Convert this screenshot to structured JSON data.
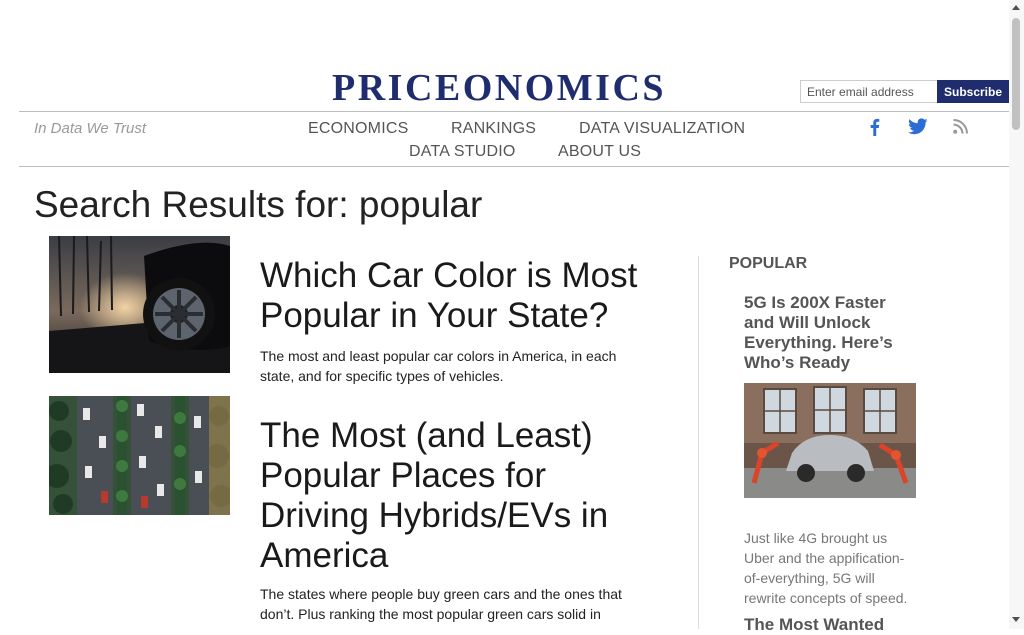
{
  "header": {
    "logo": "PRICEONOMICS",
    "email_placeholder": "Enter email address",
    "subscribe_label": "Subscribe",
    "tagline": "In Data We Trust"
  },
  "nav": {
    "economics": "ECONOMICS",
    "rankings": "RANKINGS",
    "data_visualization": "DATA VISUALIZATION",
    "data_studio": "DATA STUDIO",
    "about_us": "ABOUT US"
  },
  "social": [
    "facebook-icon",
    "twitter-icon",
    "rss-icon"
  ],
  "colors": {
    "brand": "#1f2d6e",
    "social": "#2b6cd6",
    "nav_text": "#555555",
    "sidebar_text": "#555555"
  },
  "search": {
    "title": "Search Results for: popular"
  },
  "results": [
    {
      "title": "Which Car Color is Most Popular in Your State?",
      "excerpt": "The most and least popular car colors in America, in each state, and for specific types of vehicles."
    },
    {
      "title": "The Most (and Least) Popular Places for Driving Hybrids/EVs in America",
      "excerpt": "The states where people buy green cars and the ones that don’t. Plus ranking the most popular green cars solid in"
    }
  ],
  "sidebar": {
    "title": "POPULAR",
    "posts": [
      {
        "title": "5G Is 200X Faster and Will Unlock Everything. Here’s Who’s Ready",
        "excerpt": "Just like 4G brought us Uber and the appification-of-everything, 5G will rewrite concepts of speed."
      },
      {
        "title": "The Most Wanted"
      }
    ]
  }
}
